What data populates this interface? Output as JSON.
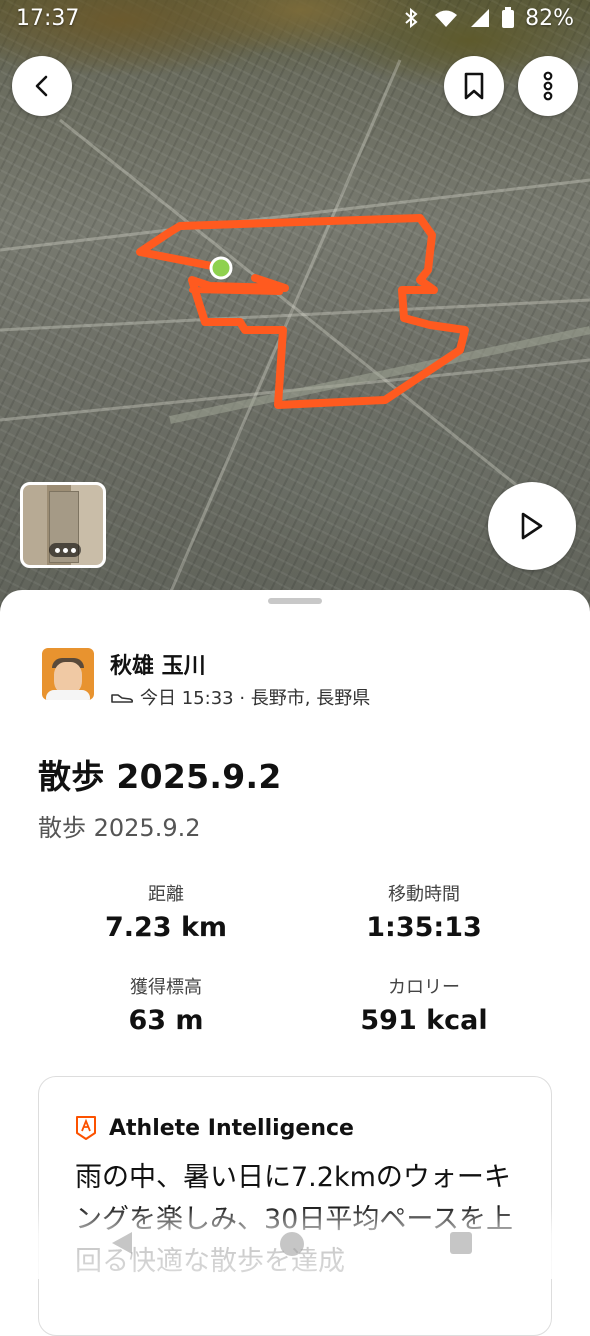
{
  "status_bar": {
    "time": "17:37",
    "battery": "82%"
  },
  "map": {
    "route_color": "#ff5a1f",
    "start_marker_color": "#8fd14f",
    "icons": {
      "back": "chevron-left-icon",
      "bookmark": "bookmark-icon",
      "more": "more-vertical-icon",
      "play": "play-icon"
    }
  },
  "user": {
    "name": "秋雄 玉川",
    "activity_meta": "今日 15:33 · 長野市, 長野県",
    "activity_icon": "shoe-icon"
  },
  "activity": {
    "title": "散歩 2025.9.2",
    "description": "散歩 2025.9.2"
  },
  "stats": [
    {
      "label": "距離",
      "value": "7.23 km"
    },
    {
      "label": "移動時間",
      "value": "1:35:13"
    },
    {
      "label": "獲得標高",
      "value": "63 m"
    },
    {
      "label": "カロリー",
      "value": "591 kcal"
    }
  ],
  "intelligence": {
    "title": "Athlete Intelligence",
    "text": "雨の中、暑い日に7.2kmのウォーキングを楽しみ、30日平均ペースを上回る快適な散歩を達成",
    "accent": "#fc5200"
  }
}
